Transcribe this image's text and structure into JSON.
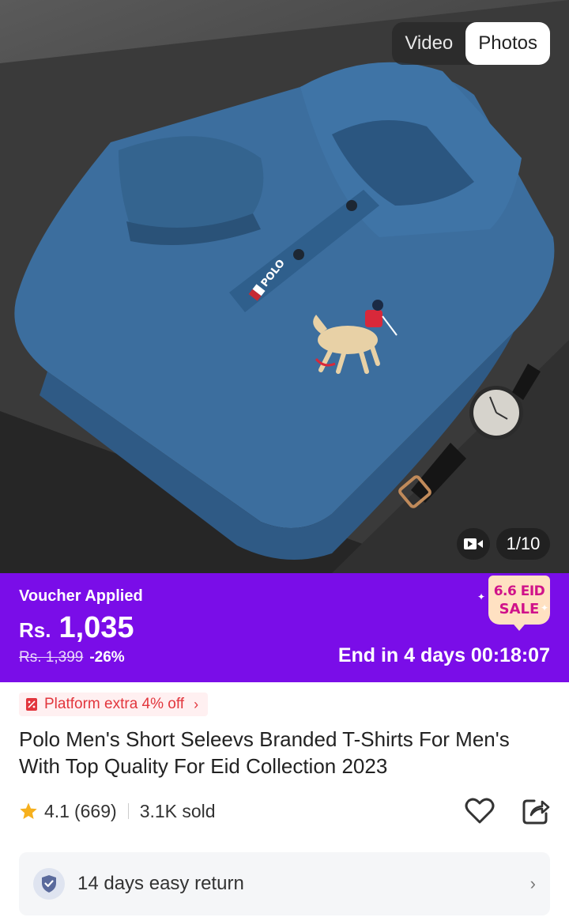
{
  "media": {
    "tabs": [
      {
        "label": "Video",
        "active": false
      },
      {
        "label": "Photos",
        "active": true
      }
    ],
    "counter": "1/10",
    "video_icon": "video-camera-icon",
    "shirt_logo_text": "POLO"
  },
  "promo": {
    "voucher_label": "Voucher Applied",
    "currency": "Rs.",
    "price": "1,035",
    "original_price": "Rs. 1,399",
    "discount": "-26%",
    "countdown": "End in 4 days 00:18:07",
    "sale_badge_line1": "6.6 EID",
    "sale_badge_line2": "SALE",
    "background_color": "#7a0de8"
  },
  "platform_offer": {
    "label": "Platform extra 4% off",
    "icon": "voucher-icon"
  },
  "product": {
    "title": "Polo Men's Short Seleevs Branded T-Shirts For Men's With Top Quality For Eid Collection 2023",
    "rating": "4.1",
    "review_count": "(669)",
    "sold": "3.1K sold"
  },
  "return_policy": {
    "label": "14 days easy return",
    "icon": "shield-check-icon"
  }
}
